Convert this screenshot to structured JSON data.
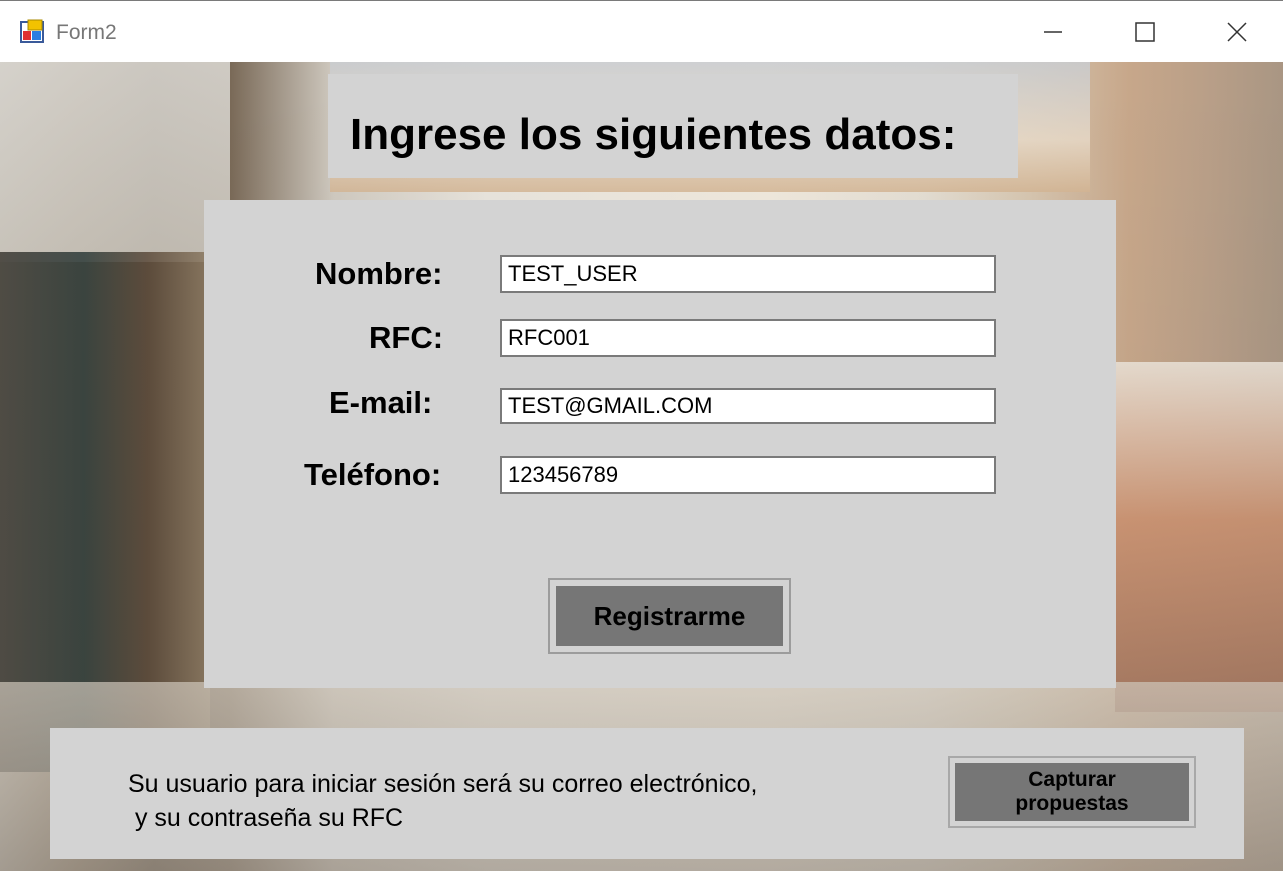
{
  "window": {
    "title": "Form2"
  },
  "heading": {
    "text": "Ingrese los siguientes datos:"
  },
  "form": {
    "nombre_label": "Nombre:",
    "nombre_value": "TEST_USER",
    "rfc_label": "RFC:",
    "rfc_value": "RFC001",
    "email_label": "E-mail:",
    "email_value": "TEST@GMAIL.COM",
    "telefono_label": "Teléfono:",
    "telefono_value": "123456789",
    "register_button": "Registrarme"
  },
  "info": {
    "line1": "Su usuario para iniciar sesión será su correo electrónico,",
    "line2": " y su contraseña su RFC",
    "capture_button": "Capturar\npropuestas"
  },
  "colors": {
    "panel": "#d3d3d3",
    "button": "#767676"
  }
}
